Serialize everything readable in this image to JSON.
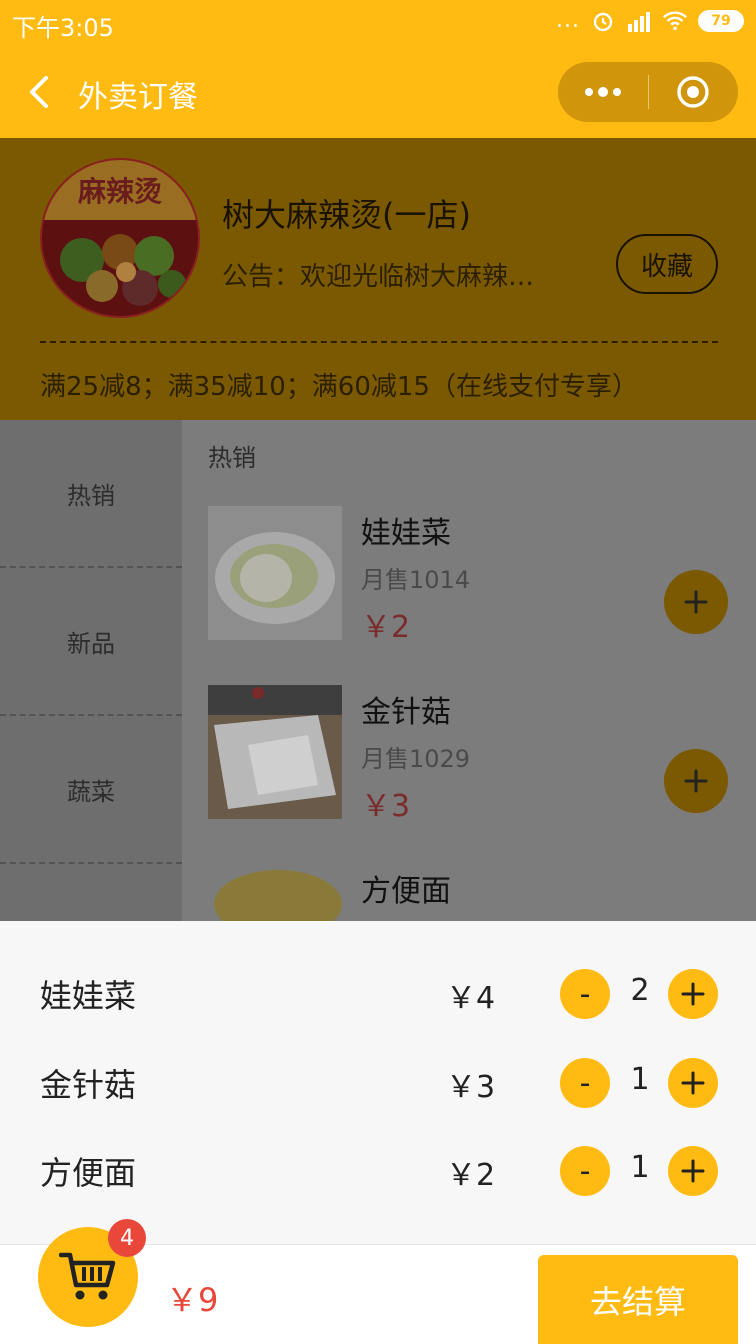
{
  "status_bar": {
    "time": "下午3:05",
    "dots": "...",
    "battery": "79"
  },
  "nav": {
    "title": "外卖订餐"
  },
  "shop": {
    "logo_text": "麻辣烫",
    "name": "树大麻辣烫(一店)",
    "notice": "公告：欢迎光临树大麻辣…",
    "favorite_label": "收藏",
    "promo": "满25减8；满35减10；满60减15（在线支付专享）"
  },
  "categories": [
    "热销",
    "新品",
    "蔬菜"
  ],
  "section_title": "热销",
  "foods": [
    {
      "name": "娃娃菜",
      "sales": "月售1014",
      "price": "￥2"
    },
    {
      "name": "金针菇",
      "sales": "月售1029",
      "price": "￥3"
    },
    {
      "name": "方便面"
    }
  ],
  "cart": {
    "items": [
      {
        "name": "娃娃菜",
        "price": "￥4",
        "qty": "2",
        "minus": "-"
      },
      {
        "name": "金针菇",
        "price": "￥3",
        "qty": "1",
        "minus": "-"
      },
      {
        "name": "方便面",
        "price": "￥2",
        "qty": "1",
        "minus": "-"
      }
    ],
    "count": "4",
    "total": "￥9",
    "checkout_label": "去结算"
  },
  "colors": {
    "accent": "#ffbb12",
    "price_red": "#e8473a",
    "badge_red": "#e8473a"
  }
}
